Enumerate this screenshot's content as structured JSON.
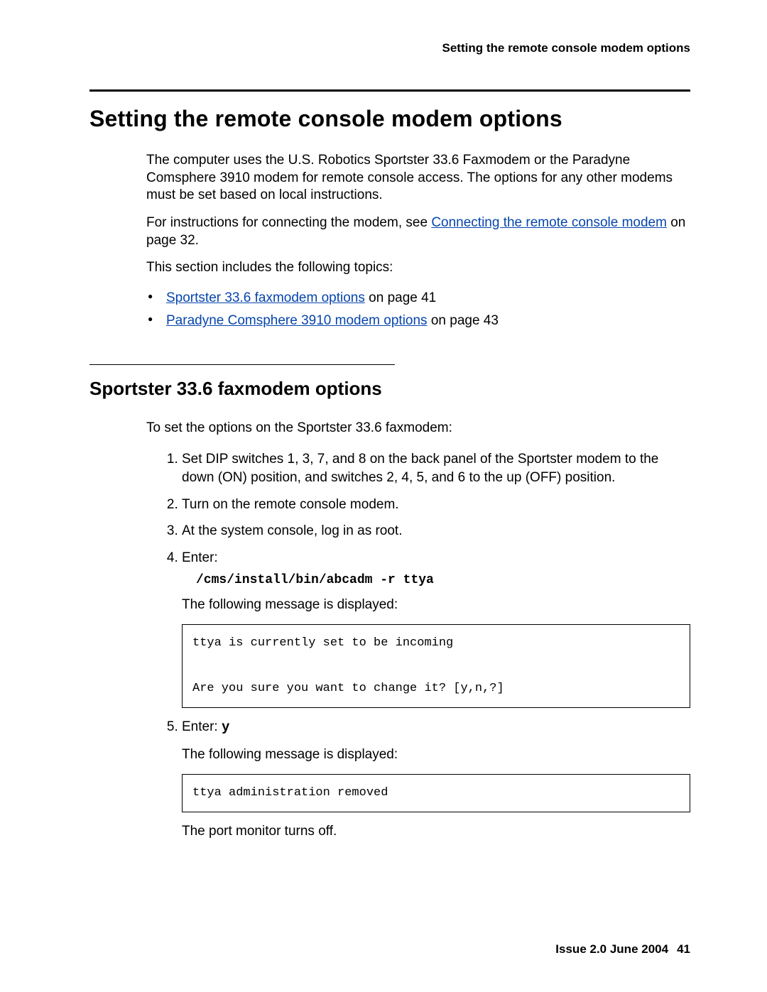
{
  "header": {
    "running_head": "Setting the remote console modem options"
  },
  "main": {
    "h1": "Setting the remote console modem options",
    "intro_p1": "The computer uses the U.S. Robotics Sportster 33.6 Faxmodem or the Paradyne Comsphere 3910 modem for remote console access. The options for any other modems must be set based on local instructions.",
    "p2_a": "For instructions for connecting the modem, see ",
    "p2_link": "Connecting the remote console modem",
    "p2_b": " on page 32.",
    "topics_lead": "This section includes the following topics:",
    "topics": [
      {
        "link": "Sportster 33.6 faxmodem options",
        "tail": " on page 41"
      },
      {
        "link": "Paradyne Comsphere 3910 modem options",
        "tail": " on page 43"
      }
    ]
  },
  "section": {
    "h2": "Sportster 33.6 faxmodem options",
    "lead": "To set the options on the Sportster 33.6 faxmodem:",
    "steps": {
      "s1": "Set DIP switches 1, 3, 7, and 8 on the back panel of the Sportster modem to the down (ON) position, and switches 2, 4, 5, and 6 to the up (OFF) position.",
      "s2": "Turn on the remote console modem.",
      "s3": "At the system console, log in as root.",
      "s4_label": "Enter:",
      "s4_cmd": "/cms/install/bin/abcadm -r ttya",
      "s4_msg_lead": "The following message is displayed:",
      "s4_box": "ttya is currently set to be incoming\n\nAre you sure you want to change it? [y,n,?]",
      "s5_a": "Enter: ",
      "s5_cmd": "y",
      "s5_msg_lead": "The following message is displayed:",
      "s5_box": "ttya administration removed",
      "s5_tail": "The port monitor turns off."
    }
  },
  "footer": {
    "issue": "Issue 2.0   June 2004",
    "page": "41"
  }
}
